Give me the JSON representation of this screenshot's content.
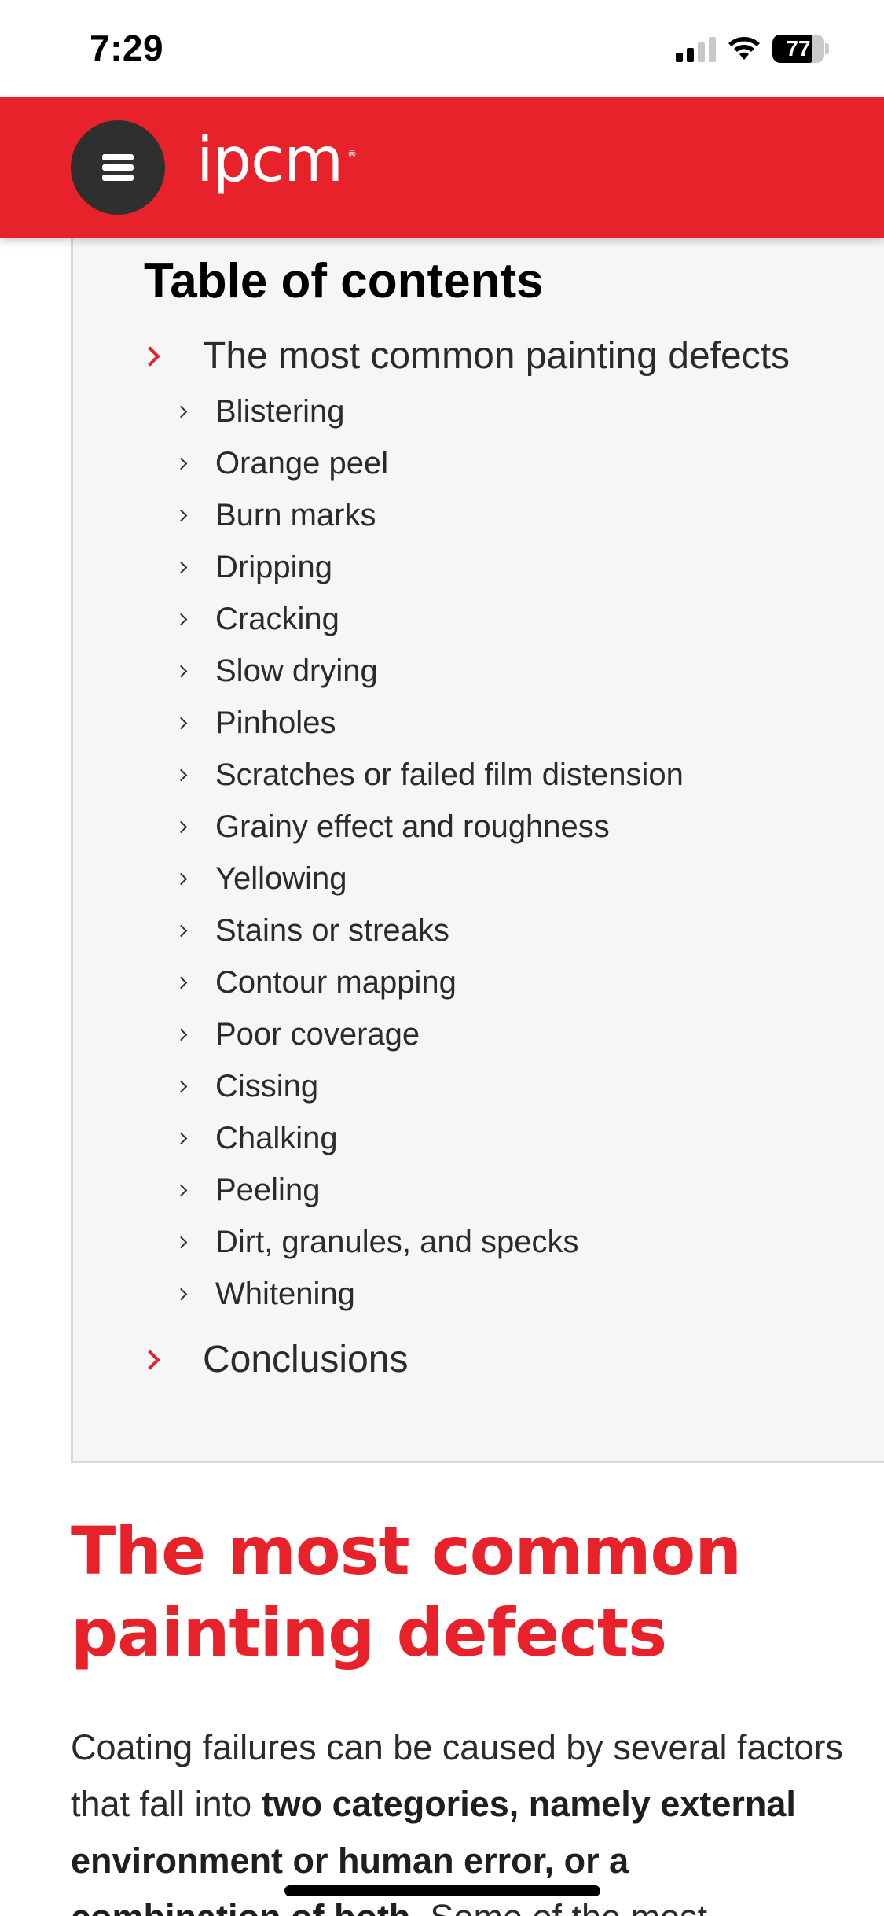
{
  "status_bar": {
    "time": "7:29",
    "battery": "77",
    "battery_level": 0.77
  },
  "header": {
    "logo": "ipcm",
    "logo_mark": "®",
    "menu_icon": "hamburger-menu-icon",
    "brand_color": "#e8222b"
  },
  "toc": {
    "title": "Table of contents",
    "section": "The most common painting defects",
    "items": [
      "Blistering",
      "Orange peel",
      "Burn marks",
      "Dripping",
      "Cracking",
      "Slow drying",
      "Pinholes",
      "Scratches or failed film distension",
      "Grainy effect and roughness",
      "Yellowing",
      "Stains or streaks",
      "Contour mapping",
      "Poor coverage",
      "Cissing",
      "Chalking",
      "Peeling",
      "Dirt, granules, and specks",
      "Whitening"
    ],
    "conclusions": "Conclusions"
  },
  "article": {
    "heading": "The most common painting defects",
    "intro_plain_1": "Coating failures can be caused by several factors that fall into ",
    "intro_bold": "two categories, namely external environment or human error, or a combination of both",
    "intro_plain_2": ". Some of the most"
  }
}
